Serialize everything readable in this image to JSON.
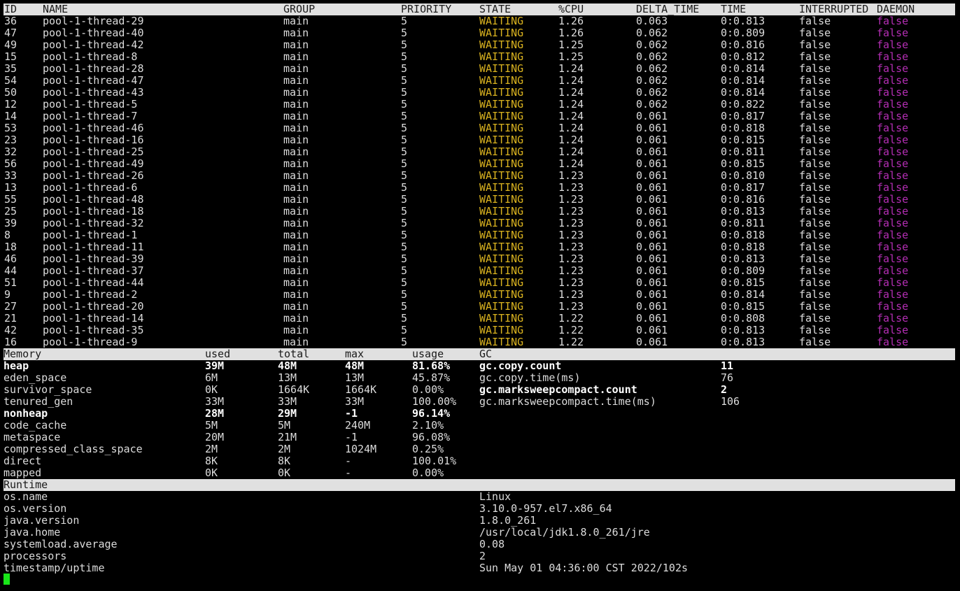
{
  "threads": {
    "headers": {
      "id": "ID",
      "name": "NAME",
      "group": "GROUP",
      "priority": "PRIORITY",
      "state": "STATE",
      "cpu": "%CPU",
      "delta_time": "DELTA_TIME",
      "time": "TIME",
      "interrupted": "INTERRUPTED",
      "daemon": "DAEMON"
    },
    "rows": [
      {
        "id": "36",
        "name": "pool-1-thread-29",
        "group": "main",
        "priority": "5",
        "state": "WAITING",
        "cpu": "1.26",
        "delta": "0.063",
        "time": "0:0.813",
        "interrupted": "false",
        "daemon": "false"
      },
      {
        "id": "47",
        "name": "pool-1-thread-40",
        "group": "main",
        "priority": "5",
        "state": "WAITING",
        "cpu": "1.26",
        "delta": "0.062",
        "time": "0:0.809",
        "interrupted": "false",
        "daemon": "false"
      },
      {
        "id": "49",
        "name": "pool-1-thread-42",
        "group": "main",
        "priority": "5",
        "state": "WAITING",
        "cpu": "1.25",
        "delta": "0.062",
        "time": "0:0.816",
        "interrupted": "false",
        "daemon": "false"
      },
      {
        "id": "15",
        "name": "pool-1-thread-8",
        "group": "main",
        "priority": "5",
        "state": "WAITING",
        "cpu": "1.25",
        "delta": "0.062",
        "time": "0:0.812",
        "interrupted": "false",
        "daemon": "false"
      },
      {
        "id": "35",
        "name": "pool-1-thread-28",
        "group": "main",
        "priority": "5",
        "state": "WAITING",
        "cpu": "1.24",
        "delta": "0.062",
        "time": "0:0.814",
        "interrupted": "false",
        "daemon": "false"
      },
      {
        "id": "54",
        "name": "pool-1-thread-47",
        "group": "main",
        "priority": "5",
        "state": "WAITING",
        "cpu": "1.24",
        "delta": "0.062",
        "time": "0:0.814",
        "interrupted": "false",
        "daemon": "false"
      },
      {
        "id": "50",
        "name": "pool-1-thread-43",
        "group": "main",
        "priority": "5",
        "state": "WAITING",
        "cpu": "1.24",
        "delta": "0.062",
        "time": "0:0.814",
        "interrupted": "false",
        "daemon": "false"
      },
      {
        "id": "12",
        "name": "pool-1-thread-5",
        "group": "main",
        "priority": "5",
        "state": "WAITING",
        "cpu": "1.24",
        "delta": "0.062",
        "time": "0:0.822",
        "interrupted": "false",
        "daemon": "false"
      },
      {
        "id": "14",
        "name": "pool-1-thread-7",
        "group": "main",
        "priority": "5",
        "state": "WAITING",
        "cpu": "1.24",
        "delta": "0.061",
        "time": "0:0.817",
        "interrupted": "false",
        "daemon": "false"
      },
      {
        "id": "53",
        "name": "pool-1-thread-46",
        "group": "main",
        "priority": "5",
        "state": "WAITING",
        "cpu": "1.24",
        "delta": "0.061",
        "time": "0:0.818",
        "interrupted": "false",
        "daemon": "false"
      },
      {
        "id": "23",
        "name": "pool-1-thread-16",
        "group": "main",
        "priority": "5",
        "state": "WAITING",
        "cpu": "1.24",
        "delta": "0.061",
        "time": "0:0.815",
        "interrupted": "false",
        "daemon": "false"
      },
      {
        "id": "32",
        "name": "pool-1-thread-25",
        "group": "main",
        "priority": "5",
        "state": "WAITING",
        "cpu": "1.24",
        "delta": "0.061",
        "time": "0:0.811",
        "interrupted": "false",
        "daemon": "false"
      },
      {
        "id": "56",
        "name": "pool-1-thread-49",
        "group": "main",
        "priority": "5",
        "state": "WAITING",
        "cpu": "1.24",
        "delta": "0.061",
        "time": "0:0.815",
        "interrupted": "false",
        "daemon": "false"
      },
      {
        "id": "33",
        "name": "pool-1-thread-26",
        "group": "main",
        "priority": "5",
        "state": "WAITING",
        "cpu": "1.23",
        "delta": "0.061",
        "time": "0:0.810",
        "interrupted": "false",
        "daemon": "false"
      },
      {
        "id": "13",
        "name": "pool-1-thread-6",
        "group": "main",
        "priority": "5",
        "state": "WAITING",
        "cpu": "1.23",
        "delta": "0.061",
        "time": "0:0.817",
        "interrupted": "false",
        "daemon": "false"
      },
      {
        "id": "55",
        "name": "pool-1-thread-48",
        "group": "main",
        "priority": "5",
        "state": "WAITING",
        "cpu": "1.23",
        "delta": "0.061",
        "time": "0:0.816",
        "interrupted": "false",
        "daemon": "false"
      },
      {
        "id": "25",
        "name": "pool-1-thread-18",
        "group": "main",
        "priority": "5",
        "state": "WAITING",
        "cpu": "1.23",
        "delta": "0.061",
        "time": "0:0.813",
        "interrupted": "false",
        "daemon": "false"
      },
      {
        "id": "39",
        "name": "pool-1-thread-32",
        "group": "main",
        "priority": "5",
        "state": "WAITING",
        "cpu": "1.23",
        "delta": "0.061",
        "time": "0:0.811",
        "interrupted": "false",
        "daemon": "false"
      },
      {
        "id": "8",
        "name": "pool-1-thread-1",
        "group": "main",
        "priority": "5",
        "state": "WAITING",
        "cpu": "1.23",
        "delta": "0.061",
        "time": "0:0.818",
        "interrupted": "false",
        "daemon": "false"
      },
      {
        "id": "18",
        "name": "pool-1-thread-11",
        "group": "main",
        "priority": "5",
        "state": "WAITING",
        "cpu": "1.23",
        "delta": "0.061",
        "time": "0:0.818",
        "interrupted": "false",
        "daemon": "false"
      },
      {
        "id": "46",
        "name": "pool-1-thread-39",
        "group": "main",
        "priority": "5",
        "state": "WAITING",
        "cpu": "1.23",
        "delta": "0.061",
        "time": "0:0.813",
        "interrupted": "false",
        "daemon": "false"
      },
      {
        "id": "44",
        "name": "pool-1-thread-37",
        "group": "main",
        "priority": "5",
        "state": "WAITING",
        "cpu": "1.23",
        "delta": "0.061",
        "time": "0:0.809",
        "interrupted": "false",
        "daemon": "false"
      },
      {
        "id": "51",
        "name": "pool-1-thread-44",
        "group": "main",
        "priority": "5",
        "state": "WAITING",
        "cpu": "1.23",
        "delta": "0.061",
        "time": "0:0.815",
        "interrupted": "false",
        "daemon": "false"
      },
      {
        "id": "9",
        "name": "pool-1-thread-2",
        "group": "main",
        "priority": "5",
        "state": "WAITING",
        "cpu": "1.23",
        "delta": "0.061",
        "time": "0:0.814",
        "interrupted": "false",
        "daemon": "false"
      },
      {
        "id": "27",
        "name": "pool-1-thread-20",
        "group": "main",
        "priority": "5",
        "state": "WAITING",
        "cpu": "1.23",
        "delta": "0.061",
        "time": "0:0.815",
        "interrupted": "false",
        "daemon": "false"
      },
      {
        "id": "21",
        "name": "pool-1-thread-14",
        "group": "main",
        "priority": "5",
        "state": "WAITING",
        "cpu": "1.22",
        "delta": "0.061",
        "time": "0:0.808",
        "interrupted": "false",
        "daemon": "false"
      },
      {
        "id": "42",
        "name": "pool-1-thread-35",
        "group": "main",
        "priority": "5",
        "state": "WAITING",
        "cpu": "1.22",
        "delta": "0.061",
        "time": "0:0.813",
        "interrupted": "false",
        "daemon": "false"
      },
      {
        "id": "16",
        "name": "pool-1-thread-9",
        "group": "main",
        "priority": "5",
        "state": "WAITING",
        "cpu": "1.22",
        "delta": "0.061",
        "time": "0:0.813",
        "interrupted": "false",
        "daemon": "false"
      }
    ]
  },
  "memory": {
    "headers": {
      "name": "Memory",
      "used": "used",
      "total": "total",
      "max": "max",
      "usage": "usage",
      "gc": "GC"
    },
    "rows": [
      {
        "name": "heap",
        "used": "39M",
        "total": "48M",
        "max": "48M",
        "usage": "81.68%",
        "bold": true
      },
      {
        "name": "eden_space",
        "used": "6M",
        "total": "13M",
        "max": "13M",
        "usage": "45.87%",
        "bold": false
      },
      {
        "name": "survivor_space",
        "used": "0K",
        "total": "1664K",
        "max": "1664K",
        "usage": "0.00%",
        "bold": false
      },
      {
        "name": "tenured_gen",
        "used": "33M",
        "total": "33M",
        "max": "33M",
        "usage": "100.00%",
        "bold": false
      },
      {
        "name": "nonheap",
        "used": "28M",
        "total": "29M",
        "max": "-1",
        "usage": "96.14%",
        "bold": true
      },
      {
        "name": "code_cache",
        "used": "5M",
        "total": "5M",
        "max": "240M",
        "usage": "2.10%",
        "bold": false
      },
      {
        "name": "metaspace",
        "used": "20M",
        "total": "21M",
        "max": "-1",
        "usage": "96.08%",
        "bold": false
      },
      {
        "name": "compressed_class_space",
        "used": "2M",
        "total": "2M",
        "max": "1024M",
        "usage": "0.25%",
        "bold": false
      },
      {
        "name": "direct",
        "used": "8K",
        "total": "8K",
        "max": "-",
        "usage": "100.01%",
        "bold": false
      },
      {
        "name": "mapped",
        "used": "0K",
        "total": "0K",
        "max": "-",
        "usage": "0.00%",
        "bold": false
      }
    ],
    "gc": [
      {
        "name": "gc.copy.count",
        "value": "11",
        "bold": true
      },
      {
        "name": "gc.copy.time(ms)",
        "value": "76",
        "bold": false
      },
      {
        "name": "gc.marksweepcompact.count",
        "value": "2",
        "bold": true
      },
      {
        "name": "gc.marksweepcompact.time(ms)",
        "value": "106",
        "bold": false
      }
    ]
  },
  "runtime": {
    "header": "Runtime",
    "rows": [
      {
        "key": "os.name",
        "value": "Linux"
      },
      {
        "key": "os.version",
        "value": "3.10.0-957.el7.x86_64"
      },
      {
        "key": "java.version",
        "value": "1.8.0_261"
      },
      {
        "key": "java.home",
        "value": "/usr/local/jdk1.8.0_261/jre"
      },
      {
        "key": "systemload.average",
        "value": "0.08"
      },
      {
        "key": "processors",
        "value": "2"
      },
      {
        "key": "timestamp/uptime",
        "value": "Sun May 01 04:36:00 CST 2022/102s"
      }
    ]
  },
  "colors": {
    "waiting": "#d9b21f",
    "daemon": "#b42eb4",
    "cursor": "#19e619",
    "header_bg": "#e0e0e0"
  }
}
